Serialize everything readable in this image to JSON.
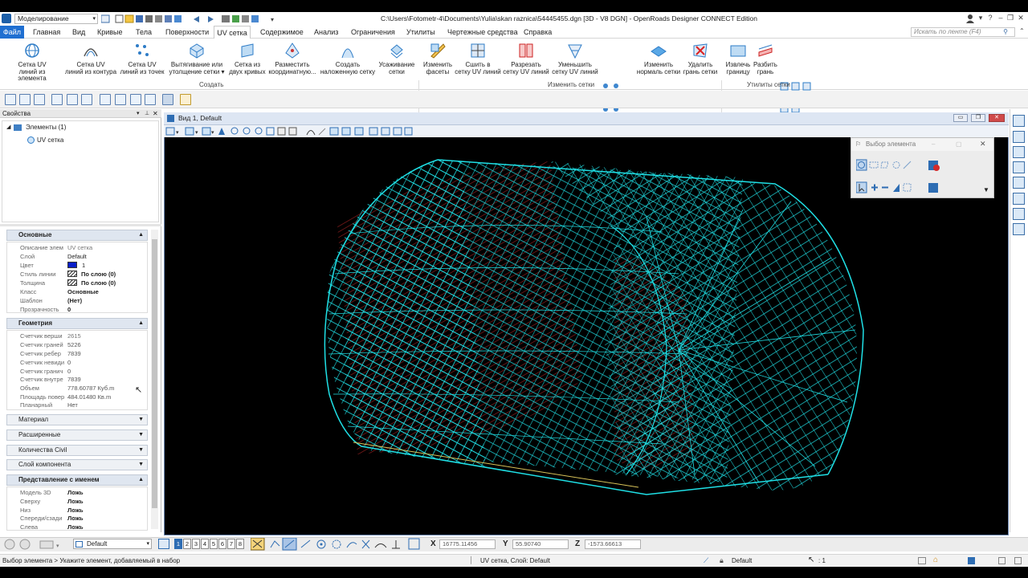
{
  "titlebar": {
    "workflow": "Моделирование",
    "path": "C:\\Users\\Fotometr-4\\Documents\\Yulia\\skan raznica\\54445455.dgn [3D - V8 DGN] - OpenRoads Designer CONNECT Edition"
  },
  "menu": {
    "items": [
      "Файл",
      "Главная",
      "Вид",
      "Кривые",
      "Тела",
      "Поверхности",
      "UV сетка",
      "Содержимое",
      "Анализ",
      "Ограничения",
      "Утилиты",
      "Чертежные средства",
      "Справка"
    ],
    "search_placeholder": "Искать по ленте (F4)"
  },
  "ribbon": {
    "buttons": [
      {
        "line1": "Сетка UV",
        "line2": "линий из элемента"
      },
      {
        "line1": "Сетка UV",
        "line2": "линий из контура"
      },
      {
        "line1": "Сетка UV",
        "line2": "линий из точек"
      },
      {
        "line1": "Вытягивание или",
        "line2": "утолщение сетки ▾"
      },
      {
        "line1": "Сетка из",
        "line2": "двух кривых"
      },
      {
        "line1": "Разместить",
        "line2": "координатную..."
      },
      {
        "line1": "Создать",
        "line2": "наложенную сетку"
      },
      {
        "line1": "Усаживание",
        "line2": "сетки"
      },
      {
        "line1": "Изменить",
        "line2": "фасеты"
      },
      {
        "line1": "Сшить в",
        "line2": "сетку UV линий"
      },
      {
        "line1": "Разрезать",
        "line2": "сетку UV линий"
      },
      {
        "line1": "Уменьшить",
        "line2": "сетку UV линий"
      },
      {
        "line1": "Изменить",
        "line2": "нормаль сетки"
      },
      {
        "line1": "Удалить",
        "line2": "грань сетки"
      },
      {
        "line1": "Извлечь",
        "line2": "границу"
      },
      {
        "line1": "Разбить",
        "line2": "грань"
      }
    ],
    "groups": [
      "Создать",
      "Изменить сетки",
      "Утилиты сетки"
    ]
  },
  "left_panel": {
    "title": "Свойства",
    "tree_root": "Элементы (1)",
    "tree_child": "UV сетка",
    "sections": {
      "basic": {
        "title": "Основные",
        "rows": [
          {
            "k": "Описание элем",
            "v": "UV сетка"
          },
          {
            "k": "Слой",
            "v": "Default"
          },
          {
            "k": "Цвет",
            "v": "1"
          },
          {
            "k": "Стиль линии",
            "v": "По слою (0)"
          },
          {
            "k": "Толщина",
            "v": "По слою (0)"
          },
          {
            "k": "Класс",
            "v": "Основные"
          },
          {
            "k": "Шаблон",
            "v": "(Нет)"
          },
          {
            "k": "Прозрачность",
            "v": "0"
          }
        ]
      },
      "geometry": {
        "title": "Геометрия",
        "rows": [
          {
            "k": "Счетчик верши",
            "v": "2615"
          },
          {
            "k": "Счетчик граней",
            "v": "5226"
          },
          {
            "k": "Счетчик ребер",
            "v": "7839"
          },
          {
            "k": "Счетчик невиди",
            "v": "0"
          },
          {
            "k": "Счетчик гранич",
            "v": "0"
          },
          {
            "k": "Счетчик внутре",
            "v": "7839"
          },
          {
            "k": "Объем",
            "v": "778.60787   Куб.m"
          },
          {
            "k": "Площадь повер",
            "v": "484.01480   Кв.m"
          },
          {
            "k": "Планарный",
            "v": "Нет"
          }
        ]
      },
      "collapsed": [
        "Материал",
        "Расширенные",
        "Количества Civil",
        "Слой компонента"
      ],
      "named": {
        "title": "Представление с именем",
        "rows": [
          {
            "k": "Модель 3D",
            "v": "Ложь"
          },
          {
            "k": "Сверху",
            "v": "Ложь"
          },
          {
            "k": "Низ",
            "v": "Ложь"
          },
          {
            "k": "Спереди/сзади",
            "v": "Ложь"
          },
          {
            "k": "Слева",
            "v": "Ложь"
          }
        ]
      }
    }
  },
  "view": {
    "title": "Вид 1, Default"
  },
  "picker": {
    "title": "Выбор элемента"
  },
  "statusbar": {
    "level": "Default",
    "viewports": [
      "1",
      "2",
      "3",
      "4",
      "5",
      "6",
      "7",
      "8"
    ],
    "x_label": "X",
    "x_value": "16775.11456",
    "y_label": "Y",
    "y_value": "55.90740",
    "z_label": "Z",
    "z_value": "-1573.66613"
  },
  "messagebar": {
    "prompt": "Выбор элемента > Укажите элемент, добавляемый в набор",
    "info": "UV сетка, Слой: Default",
    "level": "Default",
    "count": ": 1"
  },
  "colors": {
    "mesh": "#1fe0e6",
    "mesh_inner": "#8b1d1d",
    "accent": "#1f6fd1",
    "element_color": "#0a1fc9"
  }
}
